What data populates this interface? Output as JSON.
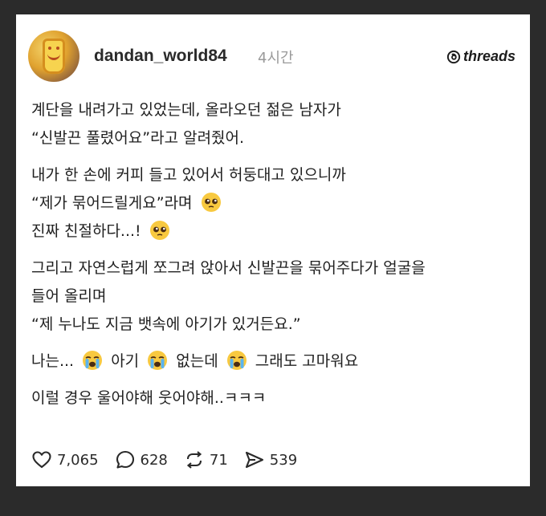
{
  "post": {
    "username": "dandan_world84",
    "time": "4시간",
    "brand": "threads",
    "paragraphs": [
      {
        "lines": [
          "계단을 내려가고 있었는데, 올라오던 젊은 남자가",
          "“신발끈 풀렸어요”라고 알려줬어."
        ]
      },
      {
        "lines": [
          "내가 한 손에 커피 들고 있어서 허둥대고 있으니까",
          "“제가 묶어드릴게요”라며",
          "진짜 친절하다...!"
        ]
      },
      {
        "lines": [
          "그리고 자연스럽게 쪼그려 앉아서 신발끈을 묶어주다가 얼굴을",
          "들어 올리며",
          "“제 누나도 지금 뱃속에 아기가 있거든요.”"
        ]
      },
      {
        "segments": [
          "나는...",
          "아기",
          "없는데",
          "그래도 고마워요"
        ]
      },
      {
        "lines": [
          "이럴 경우 울어야해 웃어야해..ㅋㅋㅋ"
        ]
      }
    ],
    "emoji": {
      "pleading": "pleading-face",
      "crying": "loudly-crying-face"
    }
  },
  "actions": {
    "likes": "7,065",
    "comments": "628",
    "reposts": "71",
    "shares": "539"
  }
}
